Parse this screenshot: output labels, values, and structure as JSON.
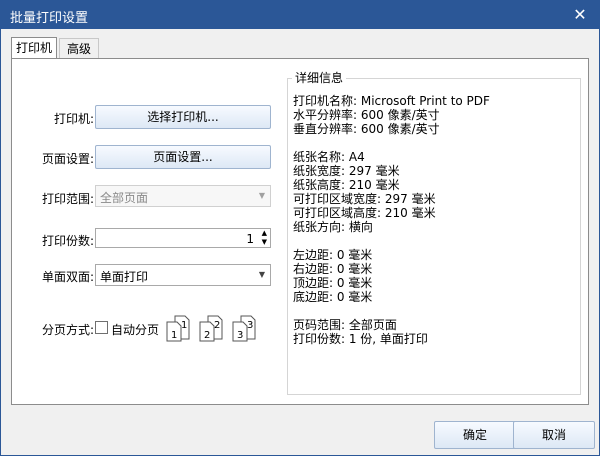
{
  "window": {
    "title": "批量打印设置",
    "close_glyph": "✕"
  },
  "tabs": [
    {
      "label": "打印机"
    },
    {
      "label": "高级"
    }
  ],
  "printer": {
    "label": "打印机:",
    "button": "选择打印机..."
  },
  "page_setup": {
    "label": "页面设置:",
    "button": "页面设置..."
  },
  "range": {
    "label": "打印范围:",
    "value": "全部页面"
  },
  "copies": {
    "label": "打印份数:",
    "value": "1"
  },
  "duplex": {
    "label": "单面双面:",
    "value": "单面打印"
  },
  "collate": {
    "label": "分页方式:",
    "checkbox_label": "自动分页",
    "checked": false,
    "icons": [
      {
        "text": "1",
        "text2": "1"
      },
      {
        "text": "2",
        "text2": "2"
      },
      {
        "text": "3",
        "text2": "3"
      }
    ]
  },
  "details": {
    "title": "详细信息",
    "lines": [
      "打印机名称: Microsoft Print to PDF",
      "水平分辨率: 600 像素/英寸",
      "垂直分辨率: 600 像素/英寸",
      "",
      "纸张名称: A4",
      "纸张宽度: 297 毫米",
      "纸张高度: 210 毫米",
      "可打印区域宽度: 297 毫米",
      "可打印区域高度: 210 毫米",
      "纸张方向: 横向",
      "",
      "左边距: 0 毫米",
      "右边距: 0 毫米",
      "顶边距: 0 毫米",
      "底边距: 0 毫米",
      "",
      "页码范围: 全部页面",
      "打印份数: 1 份, 单面打印"
    ]
  },
  "footer": {
    "ok": "确定",
    "cancel": "取消"
  }
}
